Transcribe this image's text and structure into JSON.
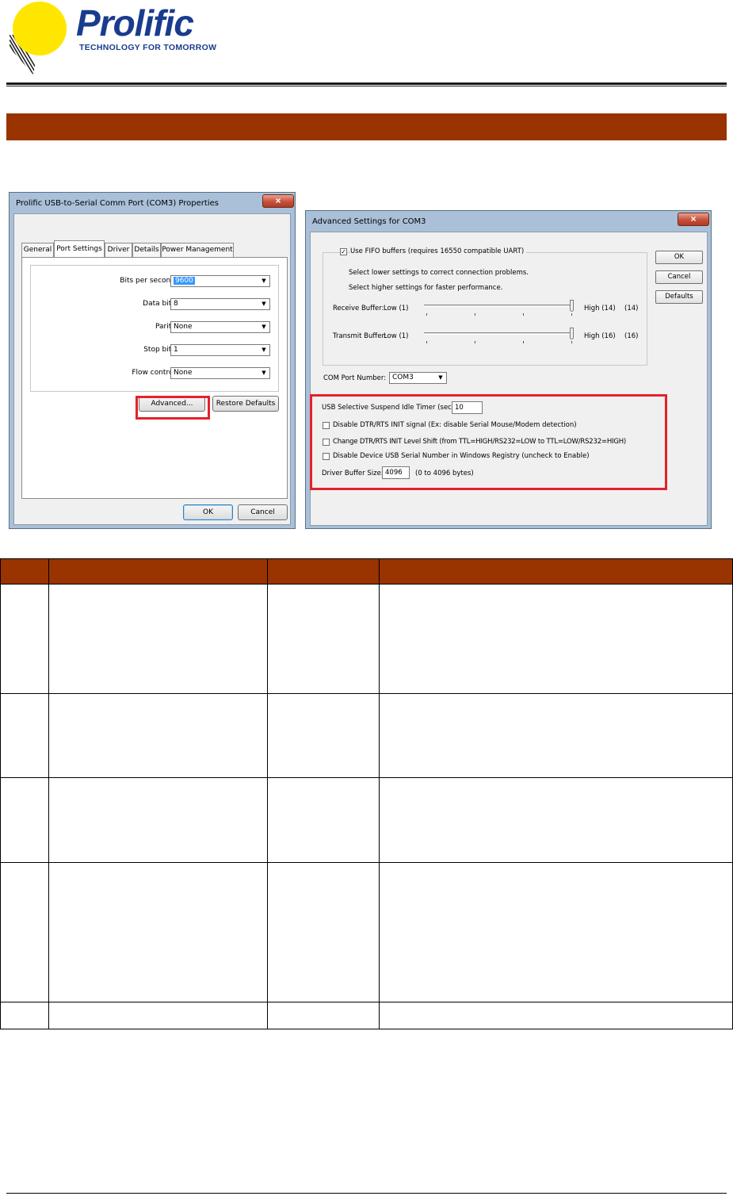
{
  "brand": {
    "name": "Prolific",
    "tagline": "TECHNOLOGY FOR TOMORROW",
    "colors": {
      "logo_blue": "#1a3c8e",
      "logo_yellow": "#ffe600",
      "accent_bar": "#993300",
      "highlight_red": "#e3222b"
    }
  },
  "port_props_dialog": {
    "title": "Prolific USB-to-Serial Comm Port (COM3) Properties",
    "close_icon": "×",
    "tabs": [
      {
        "label": "General"
      },
      {
        "label": "Port Settings",
        "active": true
      },
      {
        "label": "Driver"
      },
      {
        "label": "Details"
      },
      {
        "label": "Power Management"
      }
    ],
    "fields": [
      {
        "label": "Bits per second:",
        "value": "9600"
      },
      {
        "label": "Data bits:",
        "value": "8"
      },
      {
        "label": "Parity:",
        "value": "None"
      },
      {
        "label": "Stop bits:",
        "value": "1"
      },
      {
        "label": "Flow control:",
        "value": "None"
      }
    ],
    "advanced_button": "Advanced...",
    "restore_button": "Restore Defaults",
    "ok_button": "OK",
    "cancel_button": "Cancel"
  },
  "advanced_dialog": {
    "title": "Advanced Settings for COM3",
    "close_icon": "×",
    "fifo_checkbox": "Use FIFO buffers (requires 16550 compatible UART)",
    "fifo_checked": true,
    "hint1": "Select lower settings to correct connection problems.",
    "hint2": "Select higher settings for faster performance.",
    "receive": {
      "label": "Receive Buffer:",
      "low": "Low (1)",
      "high": "High (14)",
      "value": "(14)"
    },
    "transmit": {
      "label": "Transmit Buffer:",
      "low": "Low (1)",
      "high": "High (16)",
      "value": "(16)"
    },
    "com_port_label": "COM Port Number:",
    "com_port_value": "COM3",
    "ok_button": "OK",
    "cancel_button": "Cancel",
    "defaults_button": "Defaults",
    "suspend_label": "USB Selective Suspend Idle Timer (secs):",
    "suspend_value": "10",
    "opt1": "Disable DTR/RTS INIT signal (Ex: disable Serial Mouse/Modem detection)",
    "opt2": "Change DTR/RTS INIT Level Shift (from TTL=HIGH/RS232=LOW to TTL=LOW/RS232=HIGH)",
    "opt3": "Disable Device USB Serial Number in Windows Registry (uncheck to Enable)",
    "buffer_label": "Driver Buffer Size:",
    "buffer_value": "4096",
    "buffer_range": "(0 to 4096 bytes)"
  }
}
